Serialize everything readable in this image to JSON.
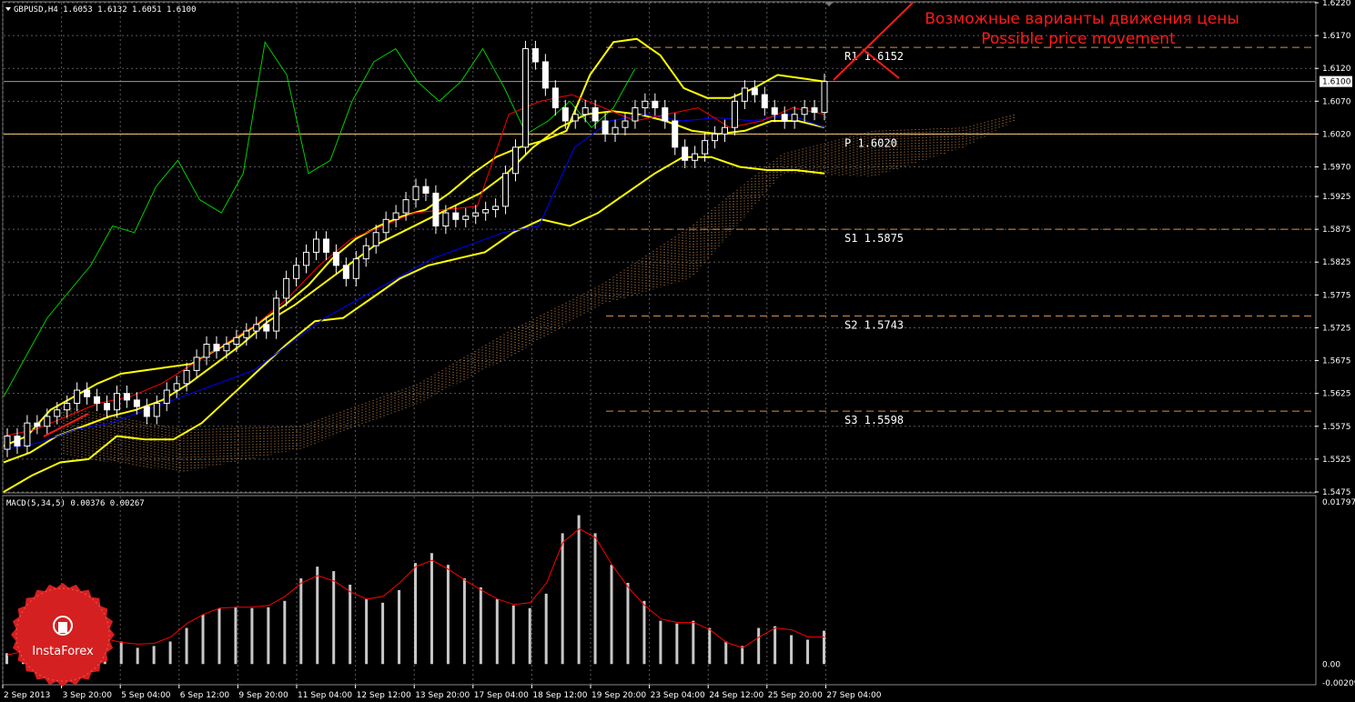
{
  "header": {
    "symbol_line": "GBPUSD,H4  1.6053 1.6132 1.6051 1.6100",
    "macd_line": "MACD(5,34,5) 0.00376 0.00267"
  },
  "annotation": {
    "line1": "Возможные варианты движения цены",
    "line2": "Possible price movement"
  },
  "watermark": {
    "text": "InstaForex"
  },
  "colors": {
    "background": "#000000",
    "grid": "#5a5a5a",
    "candle_up": "#000000",
    "candle_down": "#ffffff",
    "bollinger": "#ffff00",
    "tenkan": "#ff0000",
    "kijun": "#0000ff",
    "chikou": "#00cc00",
    "cloud": "#d2914b",
    "pivot_line": "#d2914b",
    "macd_hist": "#c8c8c8",
    "macd_signal": "#ff0000",
    "annotation": "#ff1a1a",
    "current_price_line": "#9a9a9a"
  },
  "chart_data": [
    {
      "type": "candlestick",
      "title": "GBPUSD,H4",
      "ohlc_last": {
        "open": 1.6053,
        "high": 1.6132,
        "low": 1.6051,
        "close": 1.61
      },
      "current_price": 1.61,
      "ylim": [
        1.5475,
        1.622
      ],
      "y_ticks": [
        "1.6220",
        "1.6170",
        "1.6120",
        "1.6070",
        "1.6020",
        "1.5970",
        "1.5925",
        "1.5875",
        "1.5825",
        "1.5775",
        "1.5725",
        "1.5675",
        "1.5625",
        "1.5575",
        "1.5525",
        "1.5475"
      ],
      "current_price_label": "1.6100",
      "x_tick_labels": [
        "2 Sep 2013",
        "3 Sep 20:00",
        "5 Sep 04:00",
        "6 Sep 12:00",
        "9 Sep 20:00",
        "11 Sep 04:00",
        "12 Sep 12:00",
        "13 Sep 20:00",
        "17 Sep 04:00",
        "18 Sep 12:00",
        "19 Sep 20:00",
        "23 Sep 04:00",
        "24 Sep 12:00",
        "25 Sep 20:00",
        "27 Sep 04:00"
      ],
      "pivot_levels": [
        {
          "name": "R1",
          "label": "R1  1.6152",
          "value": 1.6152
        },
        {
          "name": "P",
          "label": "P  1.6020",
          "value": 1.602
        },
        {
          "name": "S1",
          "label": "S1  1.5875",
          "value": 1.5875
        },
        {
          "name": "S2",
          "label": "S2  1.5743",
          "value": 1.5743
        },
        {
          "name": "S3",
          "label": "S3  1.5598",
          "value": 1.5598
        }
      ],
      "candles_close": [
        1.556,
        1.5545,
        1.558,
        1.5575,
        1.559,
        1.56,
        1.561,
        1.563,
        1.562,
        1.561,
        1.56,
        1.5625,
        1.5615,
        1.5605,
        1.559,
        1.561,
        1.563,
        1.564,
        1.566,
        1.568,
        1.57,
        1.569,
        1.57,
        1.571,
        1.572,
        1.573,
        1.572,
        1.577,
        1.58,
        1.582,
        1.584,
        1.586,
        1.584,
        1.582,
        1.58,
        1.583,
        1.585,
        1.587,
        1.589,
        1.59,
        1.592,
        1.594,
        1.593,
        1.588,
        1.59,
        1.589,
        1.5895,
        1.59,
        1.5905,
        1.591,
        1.596,
        1.6,
        1.615,
        1.613,
        1.609,
        1.606,
        1.604,
        1.605,
        1.606,
        1.604,
        1.602,
        1.603,
        1.604,
        1.606,
        1.607,
        1.606,
        1.604,
        1.6,
        1.598,
        1.599,
        1.601,
        1.602,
        1.603,
        1.607,
        1.609,
        1.608,
        1.606,
        1.605,
        1.604,
        1.605,
        1.606,
        1.6053,
        1.61
      ],
      "bollinger_upper": [
        1.5545,
        1.556,
        1.56,
        1.562,
        1.564,
        1.5655,
        1.566,
        1.5665,
        1.567,
        1.569,
        1.571,
        1.5735,
        1.576,
        1.579,
        1.583,
        1.586,
        1.588,
        1.5895,
        1.5905,
        1.593,
        1.596,
        1.5985,
        1.6,
        1.601,
        1.6025,
        1.611,
        1.616,
        1.6165,
        1.614,
        1.609,
        1.6075,
        1.6075,
        1.609,
        1.611,
        1.6105,
        1.61
      ],
      "bollinger_middle": [
        1.552,
        1.5535,
        1.556,
        1.5575,
        1.559,
        1.56,
        1.5615,
        1.564,
        1.567,
        1.57,
        1.5735,
        1.576,
        1.579,
        1.582,
        1.585,
        1.587,
        1.589,
        1.591,
        1.593,
        1.596,
        1.6,
        1.603,
        1.605,
        1.6055,
        1.605,
        1.604,
        1.6025,
        1.602,
        1.6025,
        1.604,
        1.604,
        1.603
      ],
      "bollinger_lower": [
        1.5475,
        1.55,
        1.552,
        1.5525,
        1.556,
        1.5555,
        1.5555,
        1.558,
        1.562,
        1.566,
        1.57,
        1.5735,
        1.574,
        1.577,
        1.58,
        1.582,
        1.583,
        1.584,
        1.587,
        1.589,
        1.588,
        1.59,
        1.593,
        1.596,
        1.5985,
        1.5985,
        1.597,
        1.5965,
        1.5965,
        1.596
      ],
      "ichimoku_tenkan": [
        1.556,
        1.557,
        1.559,
        1.561,
        1.562,
        1.564,
        1.567,
        1.57,
        1.573,
        1.577,
        1.582,
        1.586,
        1.588,
        1.59,
        1.5905,
        1.591,
        1.605,
        1.607,
        1.608,
        1.606,
        1.604,
        1.605,
        1.606,
        1.603,
        1.604,
        1.606,
        1.605
      ],
      "ichimoku_kijun": [
        1.554,
        1.555,
        1.557,
        1.558,
        1.56,
        1.562,
        1.564,
        1.566,
        1.57,
        1.574,
        1.577,
        1.58,
        1.583,
        1.585,
        1.587,
        1.588,
        1.6,
        1.604,
        1.605,
        1.604,
        1.6045,
        1.604,
        1.605,
        1.603
      ],
      "chikou": [
        1.562,
        1.568,
        1.574,
        1.578,
        1.582,
        1.588,
        1.587,
        1.594,
        1.598,
        1.592,
        1.59,
        1.596,
        1.616,
        1.611,
        1.596,
        1.598,
        1.607,
        1.613,
        1.615,
        1.61,
        1.607,
        1.61,
        1.615,
        1.609,
        1.602,
        1.604,
        1.607,
        1.603,
        1.606,
        1.612
      ],
      "macd": {
        "title": "MACD(5,34,5)",
        "value": 0.00376,
        "signal": 0.00267,
        "ylim": [
          -0.00209,
          0.01797
        ],
        "y_ticks": [
          "0.01797",
          "0.00",
          "-0.00209"
        ],
        "histogram": [
          0.0012,
          0.0015,
          0.002,
          0.0025,
          0.0028,
          0.003,
          0.0032,
          0.0025,
          0.0018,
          0.002,
          0.0025,
          0.004,
          0.0055,
          0.0062,
          0.0063,
          0.0062,
          0.0063,
          0.007,
          0.0095,
          0.0108,
          0.0103,
          0.0088,
          0.0072,
          0.0068,
          0.0082,
          0.0112,
          0.0123,
          0.011,
          0.0095,
          0.0085,
          0.0072,
          0.0065,
          0.0062,
          0.0078,
          0.0145,
          0.0165,
          0.0145,
          0.011,
          0.009,
          0.007,
          0.0048,
          0.0045,
          0.0048,
          0.004,
          0.0025,
          0.002,
          0.004,
          0.0042,
          0.0032,
          0.0027,
          0.0037
        ],
        "signal_line": [
          0.001,
          0.0014,
          0.002,
          0.0024,
          0.0027,
          0.0029,
          0.0028,
          0.0024,
          0.0022,
          0.0023,
          0.003,
          0.0045,
          0.0055,
          0.0062,
          0.0063,
          0.0063,
          0.0065,
          0.0075,
          0.009,
          0.0098,
          0.0092,
          0.008,
          0.0072,
          0.0075,
          0.009,
          0.0108,
          0.0115,
          0.0105,
          0.0093,
          0.0082,
          0.0072,
          0.0066,
          0.0068,
          0.009,
          0.0135,
          0.015,
          0.014,
          0.011,
          0.0085,
          0.0065,
          0.005,
          0.0046,
          0.0046,
          0.0038,
          0.0024,
          0.0018,
          0.003,
          0.004,
          0.0038,
          0.003,
          0.003
        ]
      }
    }
  ]
}
